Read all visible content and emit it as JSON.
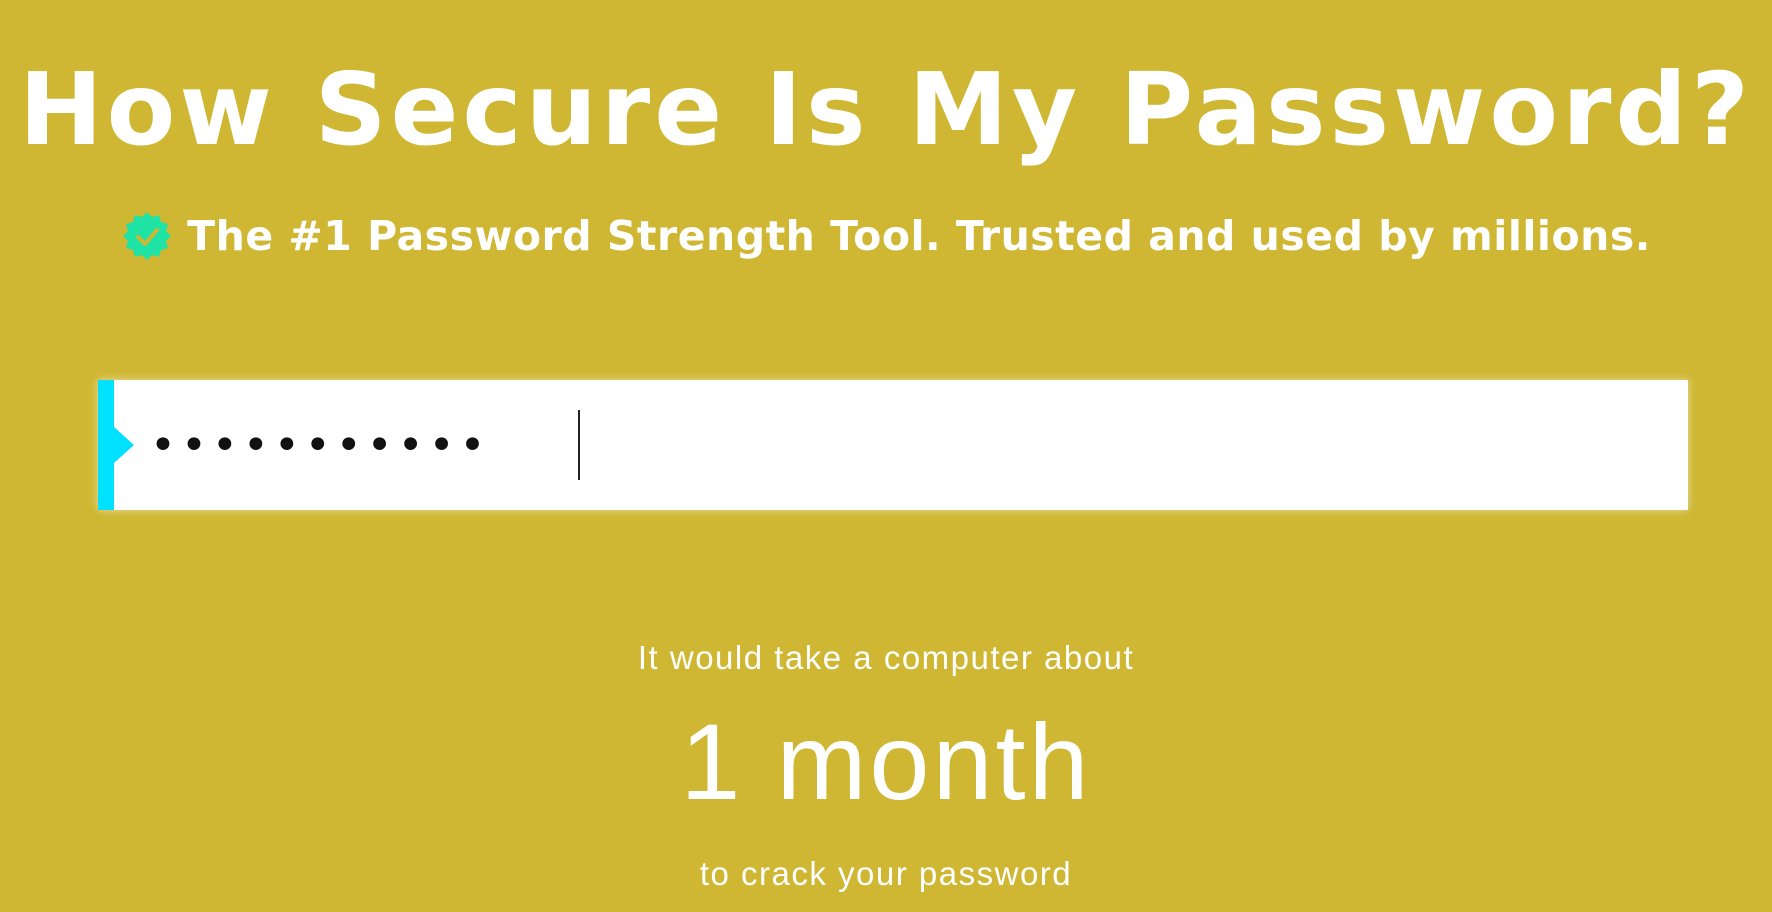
{
  "header": {
    "title": "How Secure Is My Password?",
    "tagline": "The #1 Password Strength Tool. Trusted and used by millions.",
    "badge_icon": "verified-check-icon",
    "badge_color": "#1fe3a4"
  },
  "password_field": {
    "value": "•••••••••••",
    "accent_color": "#00e0ff"
  },
  "result": {
    "lead_text": "It would take a computer about",
    "time_value": "1 month",
    "trail_text": "to crack your password"
  },
  "colors": {
    "background": "#cfb733",
    "text": "#ffffff"
  }
}
